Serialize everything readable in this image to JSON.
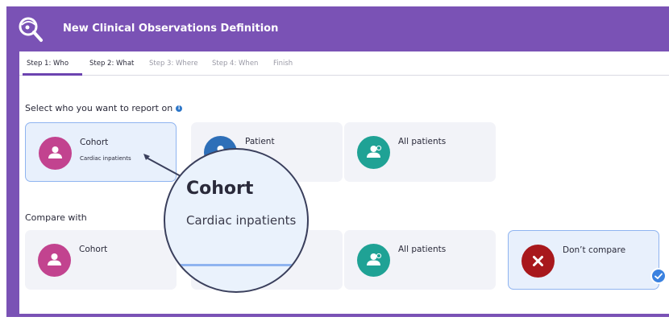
{
  "header": {
    "title": "New Clinical Observations Definition",
    "logo_icon": "magnifier-logo-icon"
  },
  "tabs": [
    {
      "label": "Step 1: Who",
      "state": "active"
    },
    {
      "label": "Step 2: What",
      "state": "complete"
    },
    {
      "label": "Step 3: Where",
      "state": "pending"
    },
    {
      "label": "Step 4: When",
      "state": "pending"
    },
    {
      "label": "Finish",
      "state": "pending"
    }
  ],
  "who": {
    "heading": "Select who you want to report on",
    "info_icon": "info-icon",
    "cards": [
      {
        "title": "Cohort",
        "subtitle": "Cardiac inpatients",
        "icon": "user-icon",
        "color": "#c2438f",
        "selected": true
      },
      {
        "title": "Patient",
        "icon": "user-icon",
        "color": "#2e6fb8",
        "selected": false
      },
      {
        "title": "All patients",
        "icon": "users-icon",
        "color": "#1fa295",
        "selected": false
      }
    ]
  },
  "compare": {
    "heading": "Compare with",
    "cards": [
      {
        "title": "Cohort",
        "icon": "user-icon",
        "color": "#c2438f",
        "selected": false
      },
      {
        "title": "All patients",
        "icon": "users-icon",
        "color": "#1fa295",
        "selected": false
      },
      {
        "title": "Don’t compare",
        "icon": "close-icon",
        "color": "#a8181c",
        "selected": true
      }
    ]
  },
  "magnifier": {
    "title": "Cohort",
    "subtitle": "Cardiac inpatients"
  },
  "colors": {
    "brand": "#7a52b5",
    "selected_border": "#8fb4f0",
    "checkmark": "#3b82e0"
  }
}
